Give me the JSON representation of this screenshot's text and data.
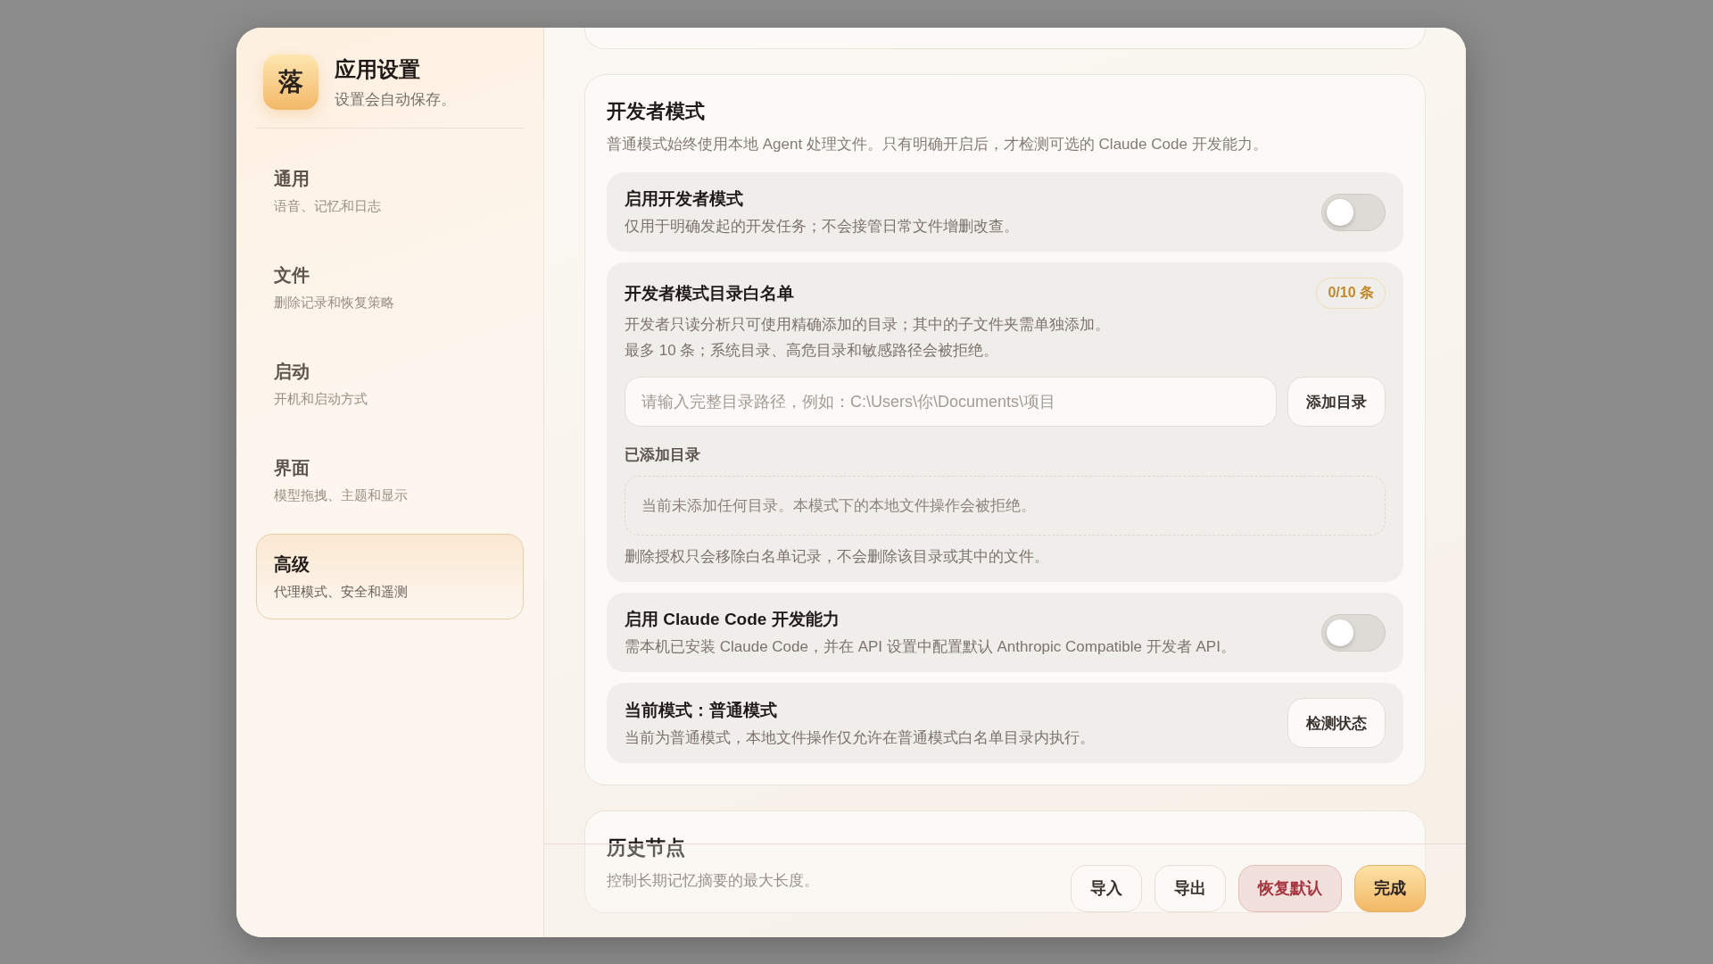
{
  "app": {
    "logo": "落",
    "title": "应用设置",
    "subtitle": "设置会自动保存。"
  },
  "sidebar": {
    "items": [
      {
        "title": "通用",
        "subtitle": "语音、记忆和日志",
        "selected": false
      },
      {
        "title": "文件",
        "subtitle": "删除记录和恢复策略",
        "selected": false
      },
      {
        "title": "启动",
        "subtitle": "开机和启动方式",
        "selected": false
      },
      {
        "title": "界面",
        "subtitle": "模型拖拽、主题和显示",
        "selected": false
      },
      {
        "title": "高级",
        "subtitle": "代理模式、安全和遥测",
        "selected": true
      }
    ]
  },
  "sections": [
    {
      "title": "开发者模式",
      "description": "普通模式始终使用本地 Agent 处理文件。只有明确开启后，才检测可选的 Claude Code 开发能力。",
      "rows": [
        {
          "kind": "toggle",
          "title": "启用开发者模式",
          "description": "仅用于明确发起的开发任务；不会接管日常文件增删改查。",
          "on": false
        },
        {
          "kind": "whitelist",
          "title": "开发者模式目录白名单",
          "badge": "0/10 条",
          "lines": [
            "开发者只读分析只可使用精确添加的目录；其中的子文件夹需单独添加。",
            "最多 10 条；系统目录、高危目录和敏感路径会被拒绝。"
          ],
          "input": {
            "placeholder": "请输入完整目录路径，例如：C:\\Users\\你\\Documents\\项目"
          },
          "button": "添加目录",
          "list_label": "已添加目录",
          "empty_text": "当前未添加任何目录。本模式下的本地文件操作会被拒绝。",
          "note": "删除授权只会移除白名单记录，不会删除该目录或其中的文件。"
        },
        {
          "kind": "toggle",
          "title": "启用 Claude Code 开发能力",
          "description": "需本机已安装 Claude Code，并在 API 设置中配置默认 Anthropic Compatible 开发者 API。",
          "on": false
        },
        {
          "kind": "status",
          "title": "当前模式：普通模式",
          "description": "当前为普通模式，本地文件操作仅允许在普通模式白名单目录内执行。",
          "button": "检测状态"
        }
      ]
    },
    {
      "title": "历史节点",
      "description": "控制长期记忆摘要的最大长度。"
    }
  ],
  "footer": {
    "buttons": [
      {
        "label": "导入",
        "kind": "plain"
      },
      {
        "label": "导出",
        "kind": "plain"
      },
      {
        "label": "恢复默认",
        "kind": "danger"
      },
      {
        "label": "完成",
        "kind": "primary"
      }
    ]
  }
}
